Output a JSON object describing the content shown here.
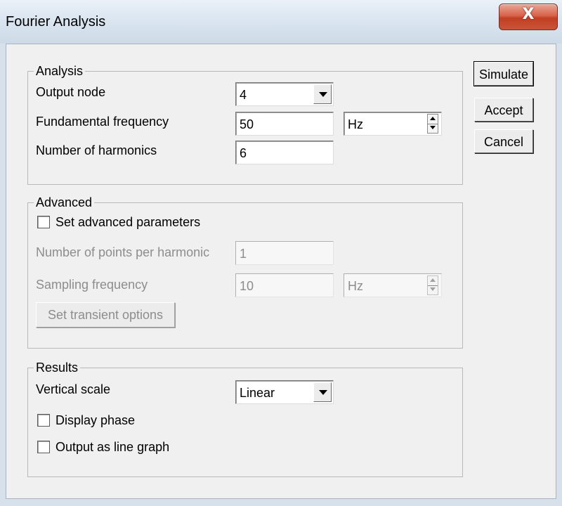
{
  "window": {
    "title": "Fourier Analysis",
    "close_label": "X"
  },
  "buttons": {
    "simulate": "Simulate",
    "accept": "Accept",
    "cancel": "Cancel"
  },
  "analysis": {
    "legend": "Analysis",
    "output_node_label": "Output node",
    "output_node_value": "4",
    "fundamental_frequency_label": "Fundamental frequency",
    "fundamental_frequency_value": "50",
    "fundamental_frequency_unit": "Hz",
    "harmonics_label": "Number of harmonics",
    "harmonics_value": "6"
  },
  "advanced": {
    "legend": "Advanced",
    "set_advanced_label": "Set advanced parameters",
    "set_advanced_checked": false,
    "points_label": "Number of points per harmonic",
    "points_value": "1",
    "sampling_label": "Sampling frequency",
    "sampling_value": "10",
    "sampling_unit": "Hz",
    "transient_button": "Set transient options"
  },
  "results": {
    "legend": "Results",
    "vertical_scale_label": "Vertical scale",
    "vertical_scale_value": "Linear",
    "display_phase_label": "Display phase",
    "display_phase_checked": false,
    "line_graph_label": "Output as line graph",
    "line_graph_checked": false
  },
  "colors": {
    "dialog_face": "#f0f0f0",
    "close_button": "#c8553a",
    "disabled_text": "#8d8d8d"
  }
}
